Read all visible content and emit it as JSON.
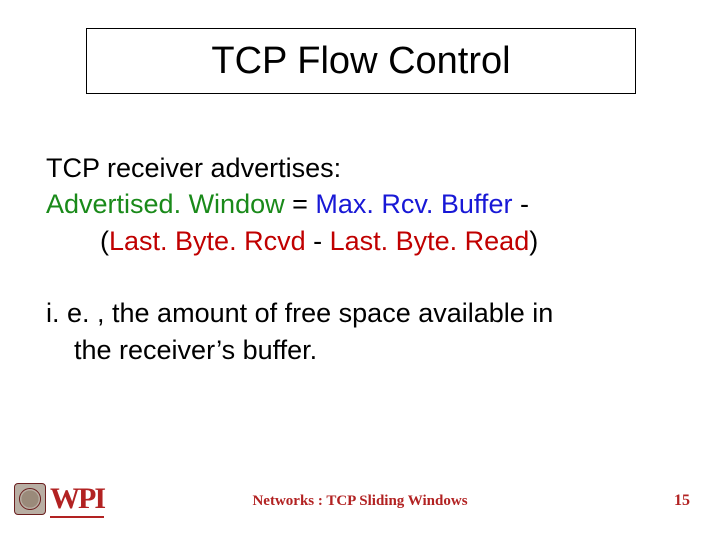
{
  "title": "TCP Flow Control",
  "body": {
    "line1": "TCP receiver advertises:",
    "advertised": "Advertised. Window",
    "eq": " = ",
    "maxrcv": "Max. Rcv. Buffer",
    "minus_trail": " -",
    "paren_open": "(",
    "last_rcvd": "Last. Byte. Rcvd",
    "mid": "  -  ",
    "last_read": "Last. Byte. Read",
    "paren_close": ")",
    "line_ie": "i. e. , the amount of free space available in",
    "line_ie2": "the receiver’s buffer."
  },
  "footer": {
    "center": "Networks : TCP Sliding Windows",
    "page": "15",
    "logo_text": "WPI"
  }
}
